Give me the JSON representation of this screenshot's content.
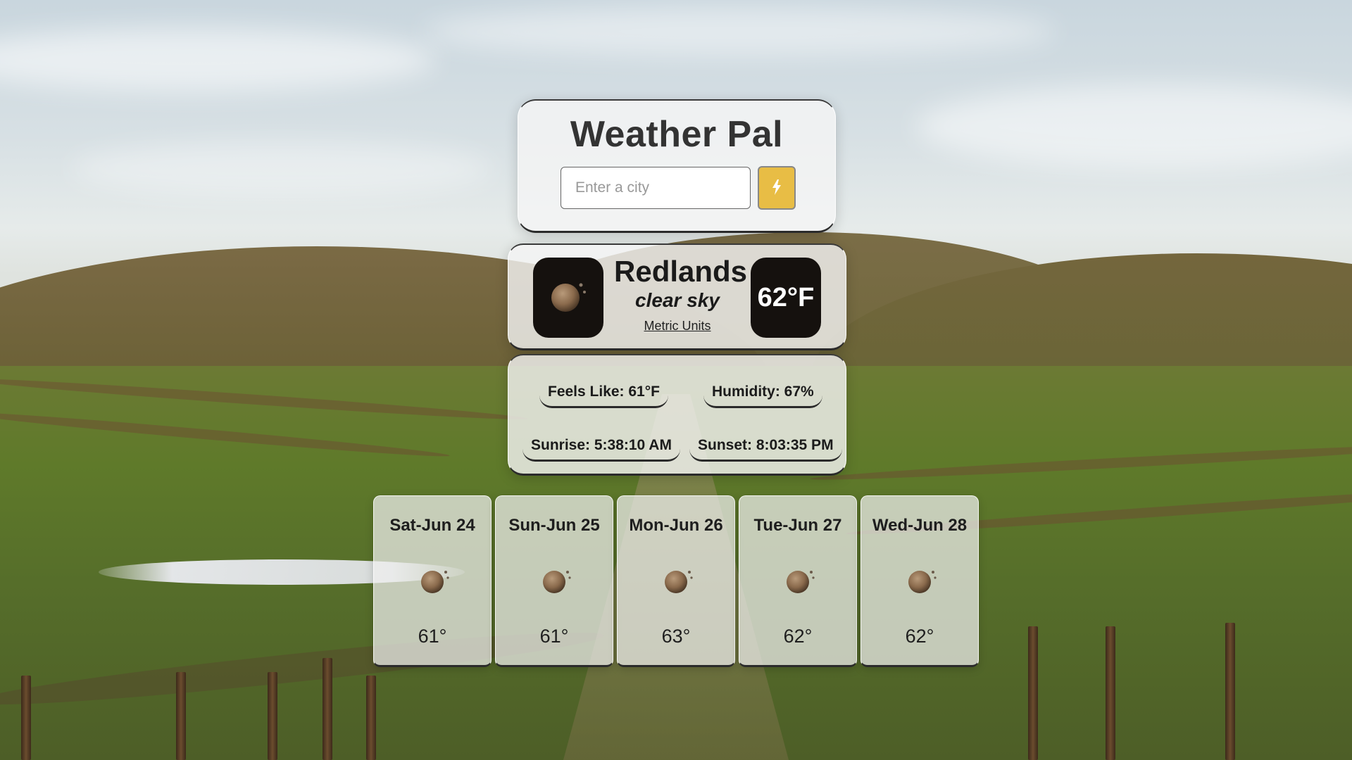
{
  "app": {
    "title": "Weather Pal"
  },
  "search": {
    "placeholder": "Enter a city",
    "value": "",
    "button_icon": "lightning-icon",
    "button_color": "#e8bd45"
  },
  "current": {
    "city": "Redlands",
    "description": "clear sky",
    "units_link": "Metric Units",
    "temperature": "62°F",
    "icon": "clear-night-moon-icon"
  },
  "details": {
    "feels_like": "Feels Like: 61°F",
    "humidity": "Humidity: 67%",
    "sunrise": "Sunrise: 5:38:10 AM",
    "sunset": "Sunset: 8:03:35 PM"
  },
  "forecast": [
    {
      "day": "Sat-Jun 24",
      "temp": "61°",
      "icon": "clear-night-moon-icon"
    },
    {
      "day": "Sun-Jun 25",
      "temp": "61°",
      "icon": "clear-night-moon-icon"
    },
    {
      "day": "Mon-Jun 26",
      "temp": "63°",
      "icon": "clear-night-moon-icon"
    },
    {
      "day": "Tue-Jun 27",
      "temp": "62°",
      "icon": "clear-night-moon-icon"
    },
    {
      "day": "Wed-Jun 28",
      "temp": "62°",
      "icon": "clear-night-moon-icon"
    }
  ]
}
